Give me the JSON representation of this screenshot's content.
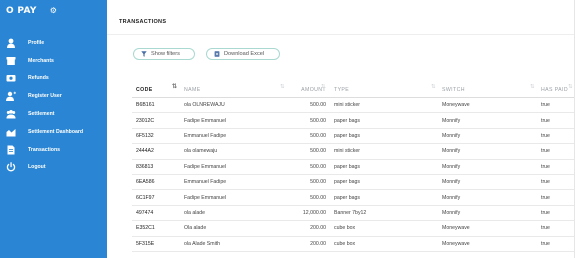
{
  "sidebar": {
    "logo": "O PAY",
    "gear_icon": "⚙",
    "items": [
      {
        "label": "Profile",
        "icon": "user-icon"
      },
      {
        "label": "Merchants",
        "icon": "storefront-icon"
      },
      {
        "label": "Refunds",
        "icon": "refund-icon"
      },
      {
        "label": "Register User",
        "icon": "add-user-icon"
      },
      {
        "label": "Settlement",
        "icon": "team-icon"
      },
      {
        "label": "Settlement Dashboard",
        "icon": "chart-icon"
      },
      {
        "label": "Transactions",
        "icon": "document-icon"
      },
      {
        "label": "Logout",
        "icon": "power-icon"
      }
    ]
  },
  "page": {
    "title": "TRANSACTIONS"
  },
  "toolbar": {
    "show_filters": "Show filters",
    "download_excel": "Download Excel"
  },
  "table": {
    "headers": {
      "code": "CODE",
      "name": "NAME",
      "amount": "AMOUNT",
      "type": "TYPE",
      "switch": "SWITCH",
      "paid": "HAS PAID"
    },
    "rows": [
      [
        "B6B161",
        "ola OLNREWAJU",
        "500.00",
        "mini sticker",
        "Moneywave",
        "true"
      ],
      [
        "23012C",
        "Fadipe Emmanuel",
        "500.00",
        "paper bags",
        "Monnify",
        "true"
      ],
      [
        "6F5132",
        "Emmanuel Fadipe",
        "500.00",
        "paper bags",
        "Monnify",
        "true"
      ],
      [
        "2444A2",
        "ola olamewaju",
        "500.00",
        "mini sticker",
        "Monnify",
        "true"
      ],
      [
        "836813",
        "Fadipe Emmanuel",
        "500.00",
        "paper bags",
        "Monnify",
        "true"
      ],
      [
        "6EA586",
        "Emmanuel Fadipe",
        "500.00",
        "paper bags",
        "Monnify",
        "true"
      ],
      [
        "6C1F97",
        "Fadipe Emmanuel",
        "500.00",
        "paper bags",
        "Monnify",
        "true"
      ],
      [
        "497474",
        "ola alade",
        "12,000.00",
        "Banner 7by12",
        "Monnify",
        "true"
      ],
      [
        "E352C1",
        "Ola alade",
        "200.00",
        "cube box",
        "Moneywave",
        "true"
      ],
      [
        "5F315E",
        "ola Alade Smith",
        "200.00",
        "cube box",
        "Moneywave",
        "true"
      ]
    ]
  }
}
